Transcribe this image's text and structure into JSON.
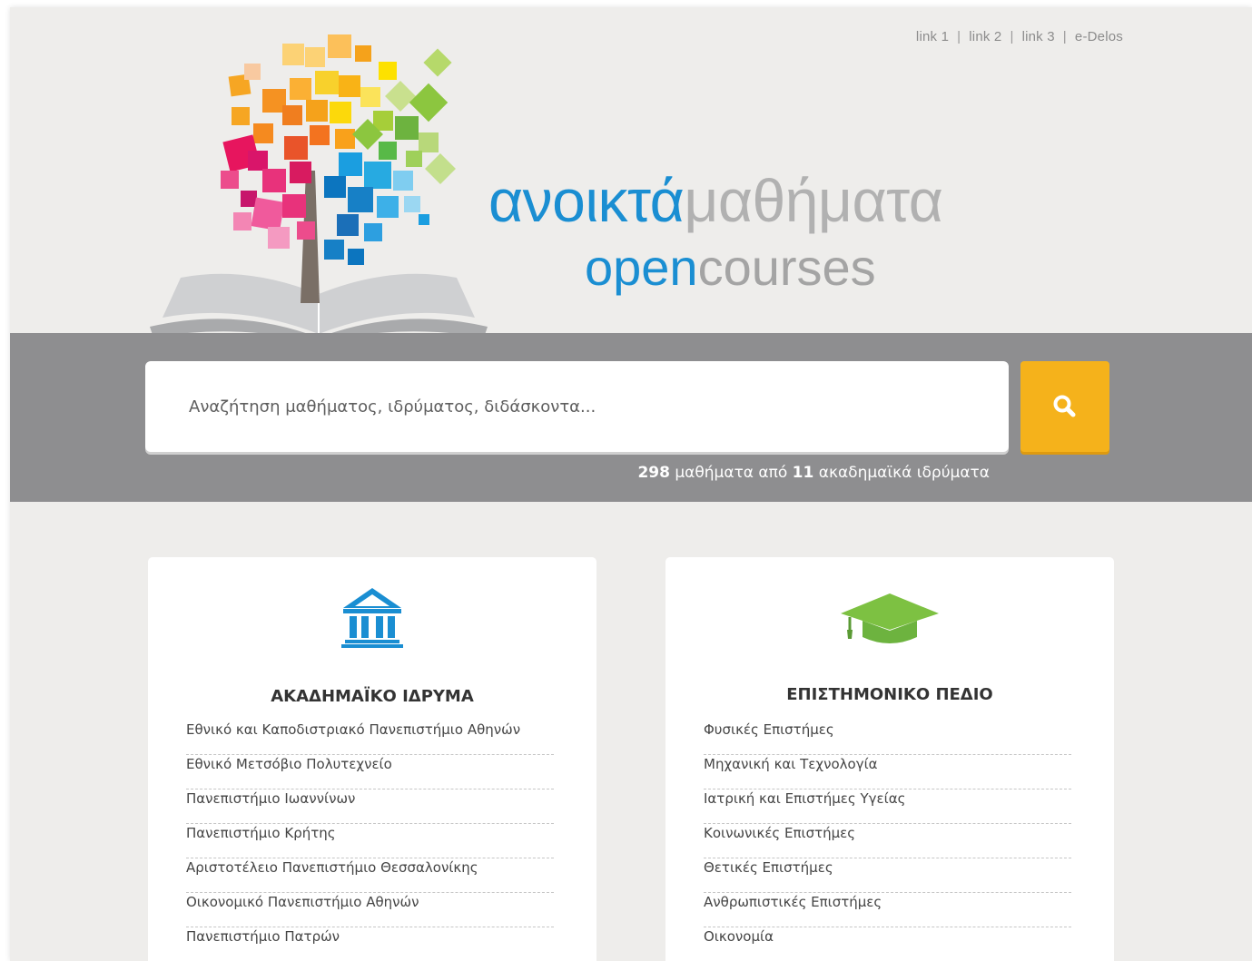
{
  "top_links": [
    "link 1",
    "link 2",
    "link 3",
    "e-Delos"
  ],
  "brand": {
    "line1_bold": "ανοικτά",
    "line1_light": "μαθήματα",
    "line2_bold": "open",
    "line2_light": "courses"
  },
  "search": {
    "placeholder": "Αναζήτηση μαθήματος, ιδρύματος, διδάσκοντα...",
    "button_icon": "search-icon"
  },
  "stats": {
    "courses_count": "298",
    "courses_label": "μαθήματα από",
    "institutions_count": "11",
    "institutions_label": "ακαδημαϊκά ιδρύματα"
  },
  "institutions": {
    "icon": "institution-building-icon",
    "title": "ΑΚΑΔΗΜΑΪΚΟ ΙΔΡΥΜΑ",
    "items": [
      "Εθνικό και Καποδιστριακό Πανεπιστήμιο Αθηνών",
      "Εθνικό Μετσόβιο Πολυτεχνείο",
      "Πανεπιστήμιο Ιωαννίνων",
      "Πανεπιστήμιο Κρήτης",
      "Αριστοτέλειο Πανεπιστήμιο Θεσσαλονίκης",
      "Οικονομικό Πανεπιστήμιο Αθηνών",
      "Πανεπιστήμιο Πατρών"
    ]
  },
  "fields": {
    "icon": "graduation-cap-icon",
    "title": "ΕΠΙΣΤΗΜΟΝΙΚΟ ΠΕΔΙΟ",
    "items": [
      "Φυσικές Επιστήμες",
      "Μηχανική και Τεχνολογία",
      "Ιατρική και Επιστήμες Υγείας",
      "Κοινωνικές Επιστήμες",
      "Θετικές Επιστήμες",
      "Ανθρωπιστικές Επιστήμες",
      "Οικονομία"
    ]
  },
  "colors": {
    "brand_blue": "#1a8ed2",
    "search_button": "#f5b21b",
    "search_band": "#8e8e90",
    "institution_icon": "#1a8ed2",
    "field_icon": "#7dc142"
  }
}
